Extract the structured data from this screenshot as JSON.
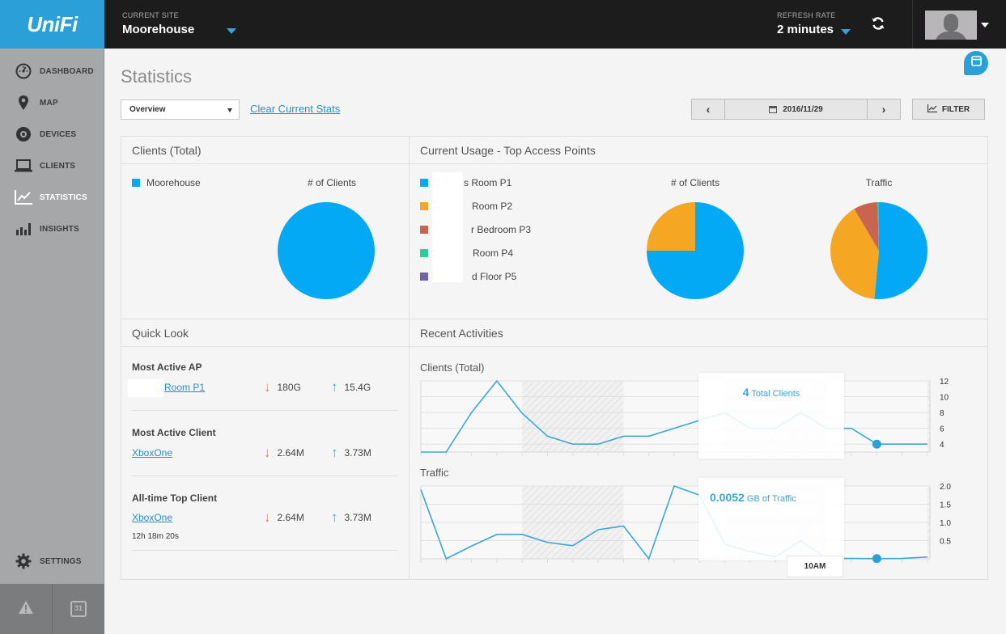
{
  "header": {
    "logo": "UniFi",
    "current_site_label": "CURRENT SITE",
    "current_site": "Moorehouse",
    "refresh_rate_label": "REFRESH RATE",
    "refresh_rate": "2 minutes"
  },
  "sidebar": {
    "items": [
      {
        "label": "DASHBOARD",
        "icon": "dashboard-gauge-icon"
      },
      {
        "label": "MAP",
        "icon": "map-pin-icon"
      },
      {
        "label": "DEVICES",
        "icon": "devices-disc-icon"
      },
      {
        "label": "CLIENTS",
        "icon": "laptop-icon"
      },
      {
        "label": "STATISTICS",
        "icon": "line-chart-icon",
        "active": true
      },
      {
        "label": "INSIGHTS",
        "icon": "bar-chart-icon"
      }
    ],
    "settings_label": "SETTINGS",
    "calendar_day": "31"
  },
  "page": {
    "title": "Statistics",
    "view_select": "Overview",
    "clear_link": "Clear Current Stats",
    "date": "2016/11/29",
    "filter_label": "FILTER"
  },
  "colors": {
    "accent": "#2a9fd8",
    "series_blue": "#03a9f4",
    "series_orange": "#f5a623",
    "series_red": "#c8644f",
    "series_green": "#2ecc9a",
    "series_purple": "#7062a6",
    "download_arrow": "#d2826f",
    "upload_arrow": "#3aa6d4"
  },
  "clients_total": {
    "title": "Clients (Total)",
    "legend": [
      {
        "label": "Moorehouse",
        "color": "#03a9f4"
      }
    ],
    "chart_title": "# of Clients"
  },
  "top_aps": {
    "title": "Current Usage - Top Access Points",
    "legend": [
      {
        "label": "s Room P1",
        "color": "#03a9f4"
      },
      {
        "label": "Room P2",
        "color": "#f5a623"
      },
      {
        "label": "r Bedroom P3",
        "color": "#c8644f"
      },
      {
        "label": "Room P4",
        "color": "#2ecc9a"
      },
      {
        "label": "d Floor P5",
        "color": "#7062a6"
      }
    ],
    "clients_chart_title": "# of Clients",
    "traffic_chart_title": "Traffic"
  },
  "quick_look": {
    "title": "Quick Look",
    "items": [
      {
        "title": "Most Active AP",
        "name": "Room P1",
        "down": "180G",
        "up": "15.4G"
      },
      {
        "title": "Most Active Client",
        "name": "XboxOne",
        "down": "2.64M",
        "up": "3.73M"
      },
      {
        "title": "All-time Top Client",
        "name": "XboxOne",
        "down": "2.64M",
        "up": "3.73M",
        "duration": "12h 18m 20s"
      }
    ]
  },
  "recent": {
    "title": "Recent Activities",
    "clients_title": "Clients (Total)",
    "clients_tooltip_value": "4",
    "clients_tooltip_unit": "Total Clients",
    "traffic_title": "Traffic",
    "traffic_tooltip_value": "0.0052",
    "traffic_tooltip_unit": "GB of Traffic",
    "time_label": "10AM"
  },
  "chart_data": [
    {
      "type": "pie",
      "title": "# of Clients",
      "categories": [
        "Moorehouse"
      ],
      "values": [
        100
      ],
      "colors": [
        "#03a9f4"
      ]
    },
    {
      "type": "pie",
      "title": "# of Clients",
      "categories": [
        "Room P1",
        "Room P2"
      ],
      "values": [
        75,
        25
      ],
      "colors": [
        "#03a9f4",
        "#f5a623"
      ]
    },
    {
      "type": "pie",
      "title": "Traffic",
      "categories": [
        "Room P1",
        "Room P2",
        "Bedroom P3",
        "Room P4"
      ],
      "values": [
        51.5,
        40,
        8,
        0.5
      ],
      "colors": [
        "#03a9f4",
        "#f5a623",
        "#c8644f",
        "#2ecc9a"
      ]
    },
    {
      "type": "line",
      "title": "Clients (Total)",
      "ylim": [
        3,
        12
      ],
      "yticks": [
        "12",
        "10",
        "8",
        "6",
        "4"
      ],
      "ytick_values": [
        12,
        10,
        8,
        6,
        4
      ],
      "values": [
        3,
        3,
        8,
        12,
        7.9,
        5,
        4,
        4,
        5,
        5,
        6,
        7,
        8,
        6,
        6,
        8,
        6,
        6,
        4,
        4,
        4
      ],
      "highlight_index": 18,
      "shaded_ranges": [
        [
          4,
          8
        ],
        [
          12,
          16
        ],
        [
          20,
          20
        ]
      ]
    },
    {
      "type": "line",
      "title": "Traffic",
      "ylim": [
        0,
        2.0
      ],
      "yticks": [
        "2.0",
        "1.5",
        "1.0",
        "0.5"
      ],
      "ytick_values": [
        2.0,
        1.5,
        1.0,
        0.5
      ],
      "values": [
        1.9,
        0.0,
        0.35,
        0.67,
        0.67,
        0.45,
        0.36,
        0.8,
        0.9,
        0.0,
        2.0,
        1.75,
        0.4,
        0.2,
        0.05,
        0.5,
        0.01,
        0.01,
        0.0052,
        0.01,
        0.05
      ],
      "highlight_index": 18,
      "shaded_ranges": [
        [
          4,
          8
        ],
        [
          12,
          16
        ],
        [
          20,
          20
        ]
      ]
    }
  ]
}
